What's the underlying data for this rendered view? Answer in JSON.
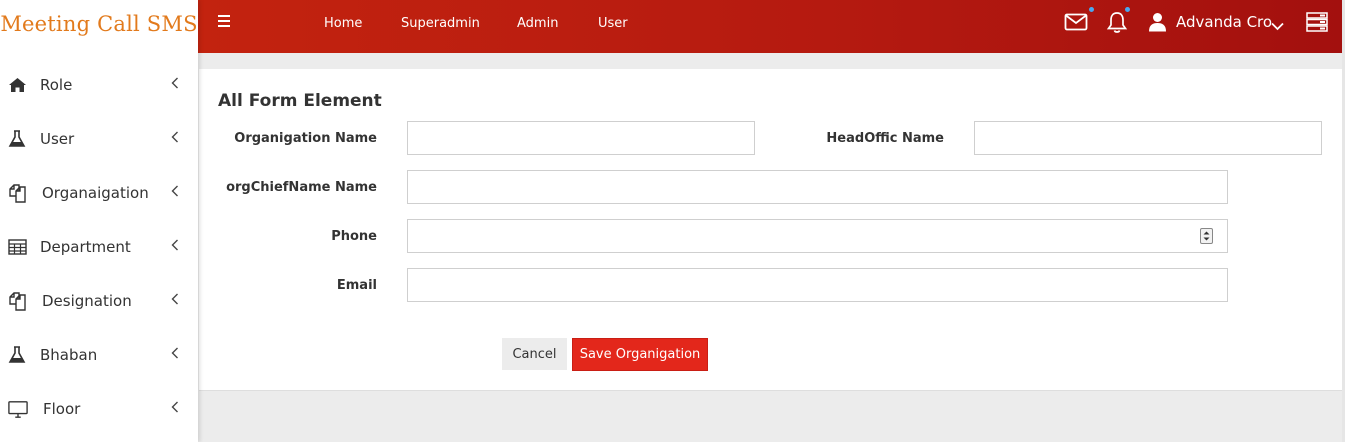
{
  "app": {
    "brand": "Meeting Call SMS"
  },
  "sidebar": {
    "items": [
      {
        "label": "Role",
        "icon": "home-icon"
      },
      {
        "label": "User",
        "icon": "flask-icon"
      },
      {
        "label": "Organaigation",
        "icon": "copy-icon"
      },
      {
        "label": "Department",
        "icon": "table-icon"
      },
      {
        "label": "Designation",
        "icon": "copy-icon"
      },
      {
        "label": "Bhaban",
        "icon": "flask-icon"
      },
      {
        "label": "Floor",
        "icon": "desktop-icon"
      }
    ]
  },
  "topbar": {
    "links": [
      "Home",
      "Superadmin",
      "Admin",
      "User"
    ],
    "user_name": "Advanda Cro",
    "colors": {
      "bar": "#b51a10",
      "notification_dot": "#4aa8f0"
    }
  },
  "form": {
    "title": "All Form Element",
    "fields": {
      "org_name": {
        "label": "Organigation Name",
        "value": ""
      },
      "head_office": {
        "label": "HeadOffic Name",
        "value": ""
      },
      "chief_name": {
        "label": "orgChiefName Name",
        "value": ""
      },
      "phone": {
        "label": "Phone",
        "value": ""
      },
      "email": {
        "label": "Email",
        "value": ""
      }
    },
    "cancel_label": "Cancel",
    "save_label": "Save Organigation",
    "colors": {
      "save": "#e3271b",
      "brand": "#e27a1c"
    }
  }
}
